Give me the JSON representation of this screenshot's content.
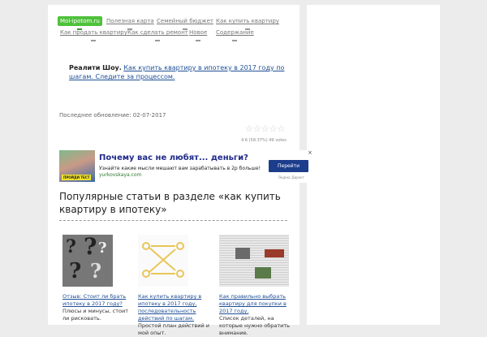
{
  "nav": {
    "items": [
      {
        "label": "Moi-ipotom.ru",
        "active": true
      },
      {
        "label": "Полезная карта",
        "active": false
      },
      {
        "label": "Семейный бюджет",
        "active": false
      },
      {
        "label": "Как купить квартиру",
        "active": false
      },
      {
        "label": "Как продать квартиру",
        "active": false
      },
      {
        "label": "Как сделать ремонт",
        "active": false
      },
      {
        "label": "Новое",
        "active": false
      },
      {
        "label": "Содержание",
        "active": false
      }
    ]
  },
  "promo": {
    "bold": "Реалити Шоу.",
    "link": "Как купить квартиру в ипотеку в 2017 году по шагам. Следите за процессом."
  },
  "updated": "Последнее обновление: 02-07-2017",
  "rating": {
    "stars_filled": 0,
    "stars_total": 5,
    "text": "4.6 (58.37%) 49 votes"
  },
  "ad": {
    "title": "Почему вас не любят... деньги?",
    "text": "Узнайте какие мысли мешают вам зарабатывать в 2р больше!",
    "domain": "yurkovskaya.com",
    "button": "Перейти",
    "close": "×",
    "label": "Яндекс.Директ",
    "badge": "ПРОЙДИ ТЕСТ"
  },
  "section": {
    "title": "Популярные статьи в разделе «как купить квартиру в ипотеку»"
  },
  "articles": [
    {
      "link": "Отзыв: Стоит ли брать ипотеку в 2017 году?",
      "text": "Плюсы и минусы, стоит ли рисковать."
    },
    {
      "link": "Как купить квартиру в ипотеку в 2017 году, последовательность действий по шагам.",
      "text": "Простой план действий и мой опыт."
    },
    {
      "link": "Как правильно выбрать квартиру для покупки в 2017 году.",
      "text": "Список деталей, на которые нужно обратить внимание."
    }
  ]
}
